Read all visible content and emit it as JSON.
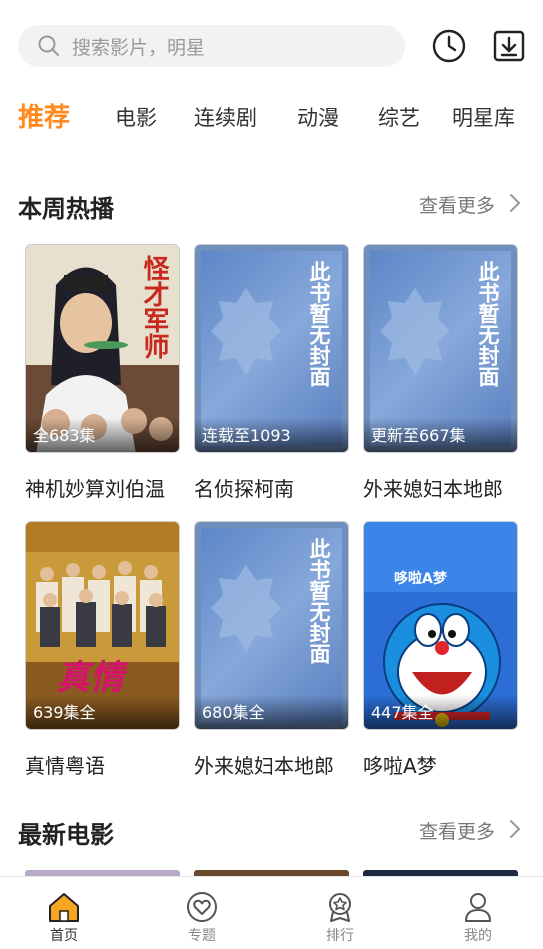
{
  "search": {
    "placeholder": "搜索影片，明星"
  },
  "tabs": [
    {
      "label": "推荐",
      "active": true
    },
    {
      "label": "电影"
    },
    {
      "label": "连续剧"
    },
    {
      "label": "动漫"
    },
    {
      "label": "综艺"
    },
    {
      "label": "明星库"
    }
  ],
  "sections": {
    "weekly": {
      "title": "本周热播",
      "more": "查看更多",
      "items": [
        {
          "title": "神机妙算刘伯温",
          "badge": "全683集",
          "cover_text": "怪才军师"
        },
        {
          "title": "名侦探柯南",
          "badge": "连载至1093"
        },
        {
          "title": "外来媳妇本地郎",
          "badge": "更新至667集"
        },
        {
          "title": "真情粤语",
          "badge": "639集全",
          "cover_text": "真情"
        },
        {
          "title": "外来媳妇本地郎",
          "badge": "680集全"
        },
        {
          "title": "哆啦A梦",
          "badge": "447集全",
          "cover_text": "哆啦A梦"
        }
      ]
    },
    "movies": {
      "title": "最新电影",
      "more": "查看更多"
    }
  },
  "placeholder_cover_text": "此书暂无封面",
  "bottom_nav": [
    {
      "label": "首页",
      "icon": "home-icon",
      "active": true
    },
    {
      "label": "专题",
      "icon": "topic-heart-icon"
    },
    {
      "label": "排行",
      "icon": "ranking-medal-icon"
    },
    {
      "label": "我的",
      "icon": "profile-icon"
    }
  ],
  "colors": {
    "accent": "#ff8a1f",
    "nav_active": "#f5a623"
  }
}
